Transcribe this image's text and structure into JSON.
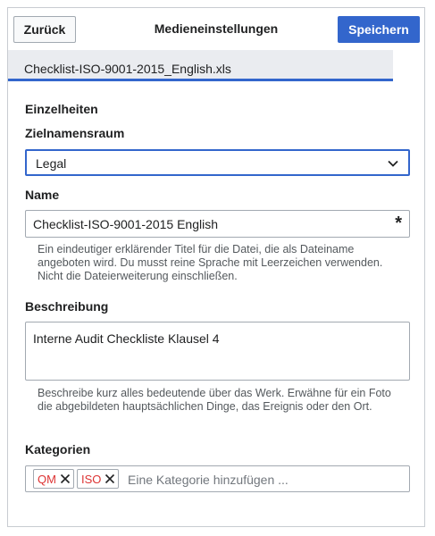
{
  "header": {
    "back_label": "Zurück",
    "title": "Medieneinstellungen",
    "save_label": "Speichern"
  },
  "file": {
    "name": "Checklist-ISO-9001-2015_English.xls"
  },
  "details": {
    "section_title": "Einzelheiten",
    "namespace": {
      "label": "Zielnamensraum",
      "value": "Legal"
    },
    "name": {
      "label": "Name",
      "value": "Checklist-ISO-9001-2015 English",
      "required_marker": "*",
      "help": "Ein eindeutiger erklärender Titel für die Datei, die als Dateiname angeboten wird. Du musst reine Sprache mit Leerzeichen verwenden. Nicht die Dateierweiterung einschließen."
    },
    "description": {
      "label": "Beschreibung",
      "value": "Interne Audit Checkliste Klausel 4",
      "help": "Beschreibe kurz alles bedeutende über das Werk. Erwähne für ein Foto die abgebildeten hauptsächlichen Dinge, das Ereignis oder den Ort."
    },
    "categories": {
      "label": "Kategorien",
      "items": [
        "QM",
        "ISO"
      ],
      "placeholder": "Eine Kategorie hinzufügen ..."
    }
  },
  "colors": {
    "accent": "#3366cc",
    "chip_text": "#dd3333"
  }
}
